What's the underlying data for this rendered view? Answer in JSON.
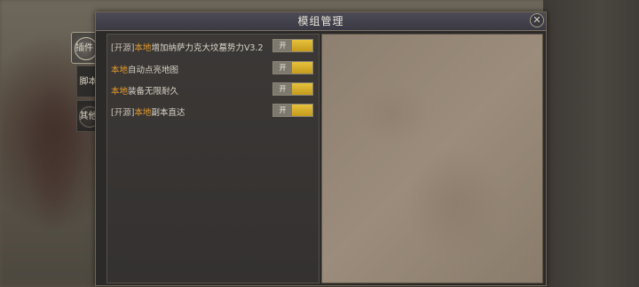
{
  "window": {
    "title": "模组管理",
    "close_icon": "close-icon"
  },
  "tabs": [
    {
      "label": "插件",
      "selected": true
    },
    {
      "label": "脚本",
      "selected": false
    },
    {
      "label": "其他",
      "selected": false
    }
  ],
  "mods": [
    {
      "tag": "[开源]",
      "local": "本地",
      "name": "增加纳萨力克大坟墓势力V3.2",
      "toggle": "开",
      "enabled": true
    },
    {
      "tag": "",
      "local": "本地",
      "name": "自动点亮地图",
      "toggle": "开",
      "enabled": true
    },
    {
      "tag": "",
      "local": "本地",
      "name": "装备无限耐久",
      "toggle": "开",
      "enabled": true
    },
    {
      "tag": "[开源]",
      "local": "本地",
      "name": "副本直达",
      "toggle": "开",
      "enabled": true
    }
  ],
  "colors": {
    "accent_orange": "#e39b2e",
    "toggle_gold": "#d4ab2a",
    "title_bar": "#43424c",
    "parchment": "#958676"
  }
}
